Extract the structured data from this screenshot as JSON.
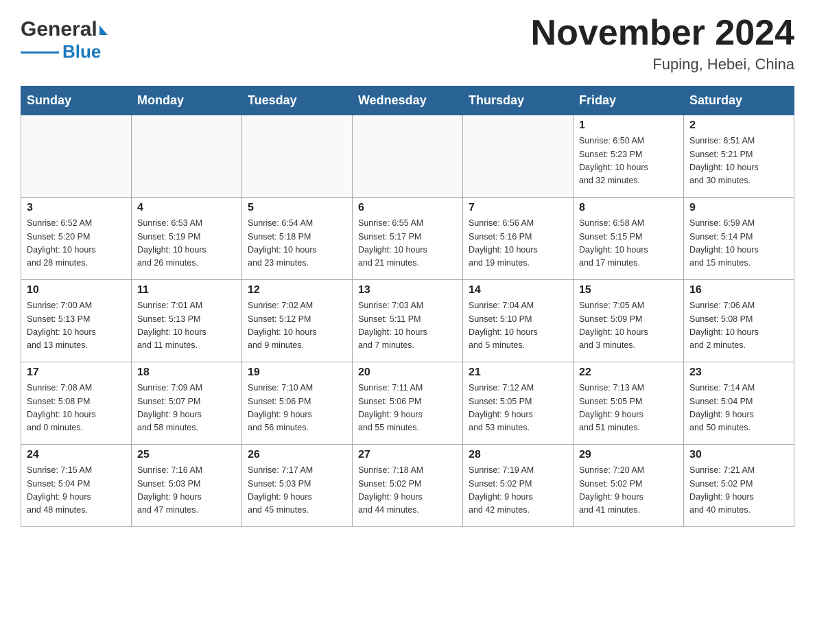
{
  "header": {
    "logo_general": "General",
    "logo_blue": "Blue",
    "month_title": "November 2024",
    "location": "Fuping, Hebei, China"
  },
  "weekdays": [
    "Sunday",
    "Monday",
    "Tuesday",
    "Wednesday",
    "Thursday",
    "Friday",
    "Saturday"
  ],
  "weeks": [
    [
      {
        "day": "",
        "info": ""
      },
      {
        "day": "",
        "info": ""
      },
      {
        "day": "",
        "info": ""
      },
      {
        "day": "",
        "info": ""
      },
      {
        "day": "",
        "info": ""
      },
      {
        "day": "1",
        "info": "Sunrise: 6:50 AM\nSunset: 5:23 PM\nDaylight: 10 hours\nand 32 minutes."
      },
      {
        "day": "2",
        "info": "Sunrise: 6:51 AM\nSunset: 5:21 PM\nDaylight: 10 hours\nand 30 minutes."
      }
    ],
    [
      {
        "day": "3",
        "info": "Sunrise: 6:52 AM\nSunset: 5:20 PM\nDaylight: 10 hours\nand 28 minutes."
      },
      {
        "day": "4",
        "info": "Sunrise: 6:53 AM\nSunset: 5:19 PM\nDaylight: 10 hours\nand 26 minutes."
      },
      {
        "day": "5",
        "info": "Sunrise: 6:54 AM\nSunset: 5:18 PM\nDaylight: 10 hours\nand 23 minutes."
      },
      {
        "day": "6",
        "info": "Sunrise: 6:55 AM\nSunset: 5:17 PM\nDaylight: 10 hours\nand 21 minutes."
      },
      {
        "day": "7",
        "info": "Sunrise: 6:56 AM\nSunset: 5:16 PM\nDaylight: 10 hours\nand 19 minutes."
      },
      {
        "day": "8",
        "info": "Sunrise: 6:58 AM\nSunset: 5:15 PM\nDaylight: 10 hours\nand 17 minutes."
      },
      {
        "day": "9",
        "info": "Sunrise: 6:59 AM\nSunset: 5:14 PM\nDaylight: 10 hours\nand 15 minutes."
      }
    ],
    [
      {
        "day": "10",
        "info": "Sunrise: 7:00 AM\nSunset: 5:13 PM\nDaylight: 10 hours\nand 13 minutes."
      },
      {
        "day": "11",
        "info": "Sunrise: 7:01 AM\nSunset: 5:13 PM\nDaylight: 10 hours\nand 11 minutes."
      },
      {
        "day": "12",
        "info": "Sunrise: 7:02 AM\nSunset: 5:12 PM\nDaylight: 10 hours\nand 9 minutes."
      },
      {
        "day": "13",
        "info": "Sunrise: 7:03 AM\nSunset: 5:11 PM\nDaylight: 10 hours\nand 7 minutes."
      },
      {
        "day": "14",
        "info": "Sunrise: 7:04 AM\nSunset: 5:10 PM\nDaylight: 10 hours\nand 5 minutes."
      },
      {
        "day": "15",
        "info": "Sunrise: 7:05 AM\nSunset: 5:09 PM\nDaylight: 10 hours\nand 3 minutes."
      },
      {
        "day": "16",
        "info": "Sunrise: 7:06 AM\nSunset: 5:08 PM\nDaylight: 10 hours\nand 2 minutes."
      }
    ],
    [
      {
        "day": "17",
        "info": "Sunrise: 7:08 AM\nSunset: 5:08 PM\nDaylight: 10 hours\nand 0 minutes."
      },
      {
        "day": "18",
        "info": "Sunrise: 7:09 AM\nSunset: 5:07 PM\nDaylight: 9 hours\nand 58 minutes."
      },
      {
        "day": "19",
        "info": "Sunrise: 7:10 AM\nSunset: 5:06 PM\nDaylight: 9 hours\nand 56 minutes."
      },
      {
        "day": "20",
        "info": "Sunrise: 7:11 AM\nSunset: 5:06 PM\nDaylight: 9 hours\nand 55 minutes."
      },
      {
        "day": "21",
        "info": "Sunrise: 7:12 AM\nSunset: 5:05 PM\nDaylight: 9 hours\nand 53 minutes."
      },
      {
        "day": "22",
        "info": "Sunrise: 7:13 AM\nSunset: 5:05 PM\nDaylight: 9 hours\nand 51 minutes."
      },
      {
        "day": "23",
        "info": "Sunrise: 7:14 AM\nSunset: 5:04 PM\nDaylight: 9 hours\nand 50 minutes."
      }
    ],
    [
      {
        "day": "24",
        "info": "Sunrise: 7:15 AM\nSunset: 5:04 PM\nDaylight: 9 hours\nand 48 minutes."
      },
      {
        "day": "25",
        "info": "Sunrise: 7:16 AM\nSunset: 5:03 PM\nDaylight: 9 hours\nand 47 minutes."
      },
      {
        "day": "26",
        "info": "Sunrise: 7:17 AM\nSunset: 5:03 PM\nDaylight: 9 hours\nand 45 minutes."
      },
      {
        "day": "27",
        "info": "Sunrise: 7:18 AM\nSunset: 5:02 PM\nDaylight: 9 hours\nand 44 minutes."
      },
      {
        "day": "28",
        "info": "Sunrise: 7:19 AM\nSunset: 5:02 PM\nDaylight: 9 hours\nand 42 minutes."
      },
      {
        "day": "29",
        "info": "Sunrise: 7:20 AM\nSunset: 5:02 PM\nDaylight: 9 hours\nand 41 minutes."
      },
      {
        "day": "30",
        "info": "Sunrise: 7:21 AM\nSunset: 5:02 PM\nDaylight: 9 hours\nand 40 minutes."
      }
    ]
  ]
}
